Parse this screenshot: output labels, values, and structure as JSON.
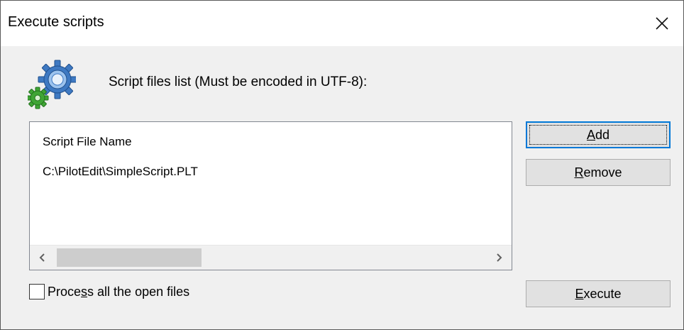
{
  "dialog": {
    "title": "Execute scripts",
    "close_icon": "close-icon",
    "header_icon": "gears-icon",
    "header_label": "Script files list (Must be encoded in UTF-8):"
  },
  "file_list": {
    "column_header": "Script File Name",
    "rows": [
      "C:\\PilotEdit\\SimpleScript.PLT"
    ],
    "scroll_left_icon": "chevron-left-icon",
    "scroll_right_icon": "chevron-right-icon"
  },
  "buttons": {
    "add": {
      "mnemonic": "A",
      "rest": "dd"
    },
    "remove": {
      "mnemonic": "R",
      "rest": "emove"
    },
    "execute": {
      "mnemonic": "E",
      "rest": "xecute"
    }
  },
  "checkbox": {
    "label_before": "Proce",
    "label_mnemonic": "s",
    "label_after": "s all the open files",
    "checked": false
  },
  "colors": {
    "accent": "#0078d7",
    "gear_blue": "#3e79c2",
    "gear_green": "#3fa535"
  }
}
